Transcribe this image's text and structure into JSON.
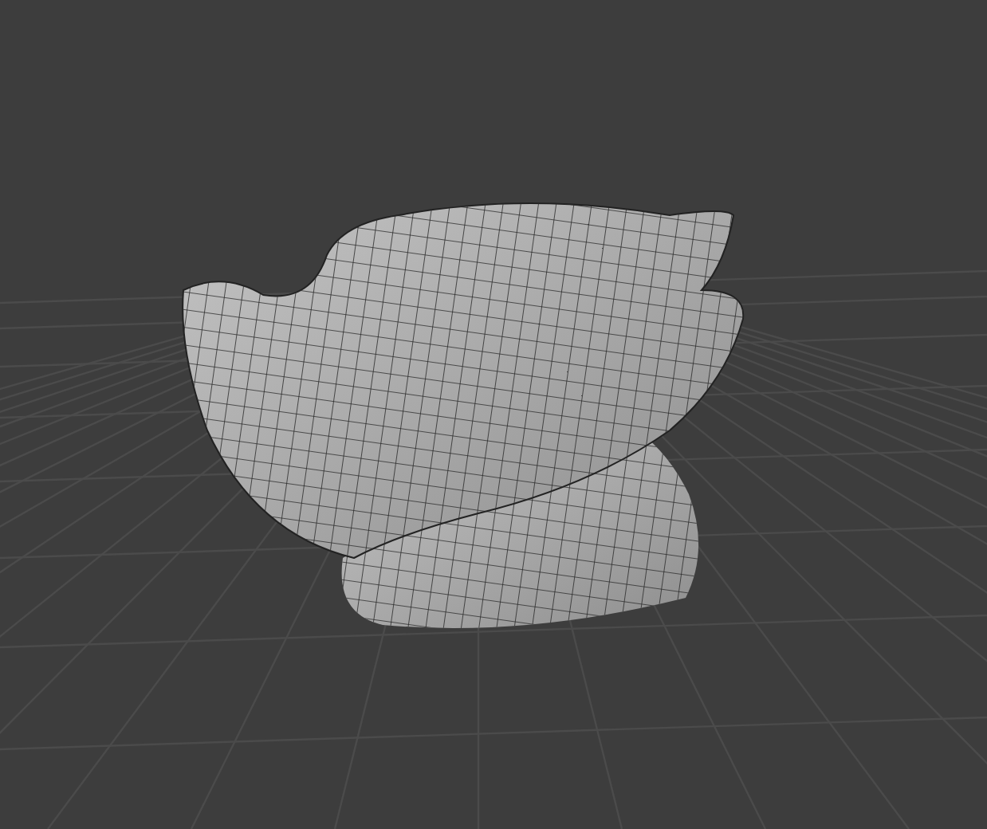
{
  "viewport": {
    "show_grid": true,
    "show_mesh": true
  }
}
